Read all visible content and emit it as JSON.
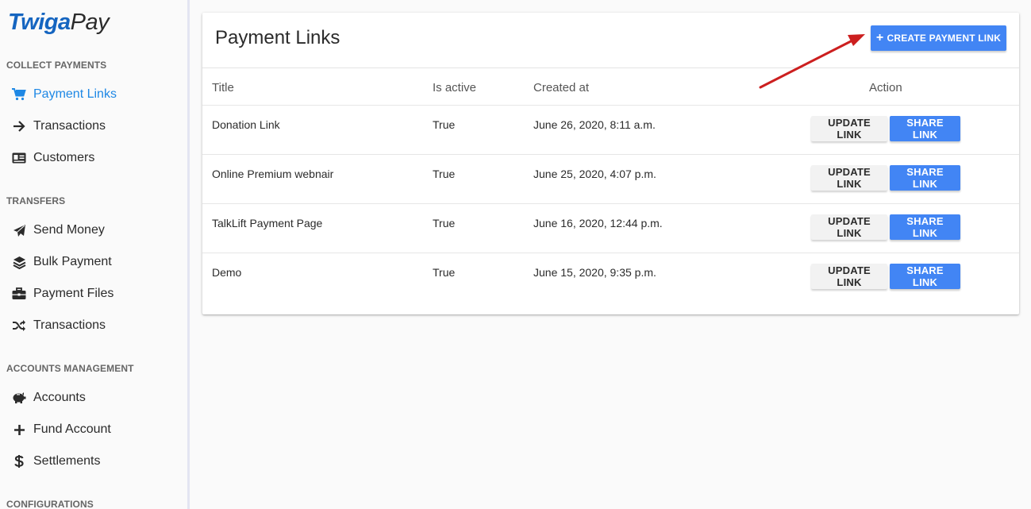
{
  "brand": {
    "part1": "Twiga",
    "part2": "Pay"
  },
  "sidebar": {
    "sections": [
      {
        "title": "COLLECT PAYMENTS",
        "items": [
          {
            "label": "Payment Links",
            "icon": "cart-icon",
            "active": true
          },
          {
            "label": "Transactions",
            "icon": "arrow-right-icon"
          },
          {
            "label": "Customers",
            "icon": "id-card-icon"
          }
        ]
      },
      {
        "title": "TRANSFERS",
        "items": [
          {
            "label": "Send Money",
            "icon": "paper-plane-icon"
          },
          {
            "label": "Bulk Payment",
            "icon": "layers-icon"
          },
          {
            "label": "Payment Files",
            "icon": "briefcase-icon"
          },
          {
            "label": "Transactions",
            "icon": "shuffle-icon"
          }
        ]
      },
      {
        "title": "ACCOUNTS MANAGEMENT",
        "items": [
          {
            "label": "Accounts",
            "icon": "piggy-bank-icon"
          },
          {
            "label": "Fund Account",
            "icon": "plus-icon"
          },
          {
            "label": "Settlements",
            "icon": "dollar-icon"
          }
        ]
      },
      {
        "title": "CONFIGURATIONS",
        "items": []
      }
    ]
  },
  "main": {
    "title": "Payment Links",
    "create_button": "CREATE PAYMENT LINK",
    "table": {
      "headers": {
        "title": "Title",
        "is_active": "Is active",
        "created_at": "Created at",
        "action": "Action"
      },
      "rows": [
        {
          "title": "Donation Link",
          "is_active": "True",
          "created_at": "June 26, 2020, 8:11 a.m.",
          "update": "UPDATE LINK",
          "share": "SHARE LINK"
        },
        {
          "title": "Online Premium webnair",
          "is_active": "True",
          "created_at": "June 25, 2020, 4:07 p.m.",
          "update": "UPDATE LINK",
          "share": "SHARE LINK"
        },
        {
          "title": "TalkLift Payment Page",
          "is_active": "True",
          "created_at": "June 16, 2020, 12:44 p.m.",
          "update": "UPDATE LINK",
          "share": "SHARE LINK"
        },
        {
          "title": "Demo",
          "is_active": "True",
          "created_at": "June 15, 2020, 9:35 p.m.",
          "update": "UPDATE LINK",
          "share": "SHARE LINK"
        }
      ]
    }
  },
  "colors": {
    "accent": "#4285f4",
    "active_nav": "#1e88e5",
    "brand_blue": "#1565c0",
    "annotation_arrow": "#cc1f1f"
  }
}
